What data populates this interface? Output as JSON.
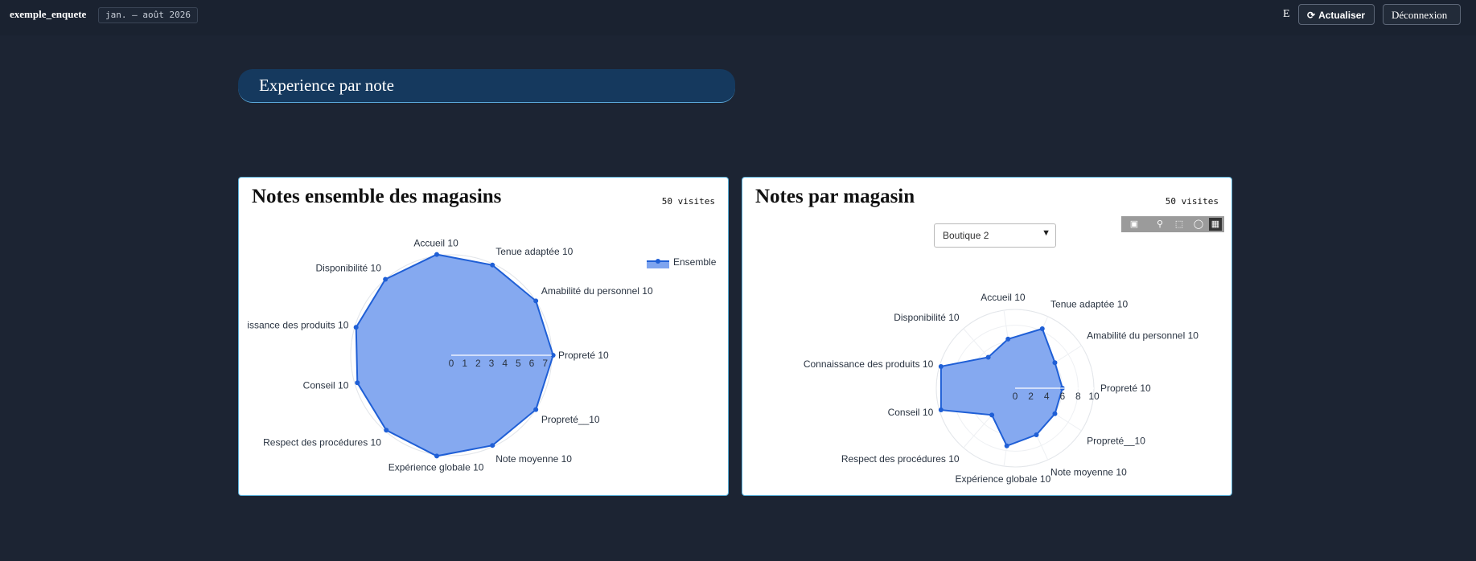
{
  "header": {
    "app_name": "exemple_enquete",
    "period": "jan. – août 2026",
    "user_initial": "E",
    "refresh_label": "Actualiser",
    "logout_label": "Déconnexion"
  },
  "section": {
    "title": "Experience par note"
  },
  "colors": {
    "background": "#1c2433",
    "banner": "#15395e",
    "radar_fill": "#7ea4ef",
    "radar_line": "#1f5fd6"
  },
  "card_left": {
    "title": "Notes ensemble des magasins",
    "visits": "50 visites"
  },
  "card_right": {
    "title": "Notes par magasin",
    "visits": "50 visites",
    "store_select": {
      "selected": "Boutique 2"
    },
    "toolbar_icons": [
      "camera-icon",
      "zoom-icon",
      "box-select-icon",
      "lasso-icon",
      "plotly-logo-icon"
    ]
  },
  "chart_data": [
    {
      "type": "radar",
      "title": "Notes ensemble des magasins",
      "legend": {
        "entries": [
          "Ensemble"
        ],
        "placement": "top-right"
      },
      "radial_ticks": [
        "0",
        "1",
        "2",
        "3",
        "4",
        "5",
        "6",
        "7"
      ],
      "rmax": 7.5,
      "categories": [
        "Propreté",
        "Amabilité du personnel",
        "Tenue adaptée",
        "Accueil",
        "Disponibilité",
        "Connaissance des produits",
        "Conseil",
        "Respect des procédures",
        "Expérience globale",
        "Note moyenne",
        "Propreté__10"
      ],
      "category_labels": [
        "Propreté  10",
        "Amabilité du personnel  10",
        "Tenue adaptée  10",
        "Accueil  10",
        "Disponibilité  10",
        "issance des produits  10",
        "Conseil  10",
        "Respect des procédures  10",
        "Expérience globale  10",
        "Note moyenne  10",
        "Propreté__10"
      ],
      "series": [
        {
          "name": "Ensemble",
          "values": [
            7.6,
            7.5,
            7.4,
            7.6,
            7.5,
            7.4,
            7.3,
            7.4,
            7.6,
            7.4,
            7.5
          ]
        }
      ]
    },
    {
      "type": "radar",
      "title": "Notes par magasin",
      "radial_ticks": [
        "0",
        "2",
        "4",
        "6",
        "8",
        "10"
      ],
      "rmax": 10,
      "categories": [
        "Propreté",
        "Amabilité du personnel",
        "Tenue adaptée",
        "Accueil",
        "Disponibilité",
        "Connaissance des produits",
        "Conseil",
        "Respect des procédures",
        "Expérience globale",
        "Note moyenne",
        "Propreté__10"
      ],
      "category_labels": [
        "Propreté  10",
        "Amabilité du personnel  10",
        "Tenue adaptée  10",
        "Accueil  10",
        "Disponibilité  10",
        "Connaissance des produits  10",
        "Conseil  10",
        "Respect des procédures  10",
        "Expérience globale  10",
        "Note moyenne  10",
        "Propreté__10"
      ],
      "series": [
        {
          "values": [
            6,
            6,
            8.3,
            6.3,
            5.2,
            9.8,
            9.8,
            4.5,
            7.4,
            6.5,
            6
          ]
        }
      ]
    }
  ]
}
